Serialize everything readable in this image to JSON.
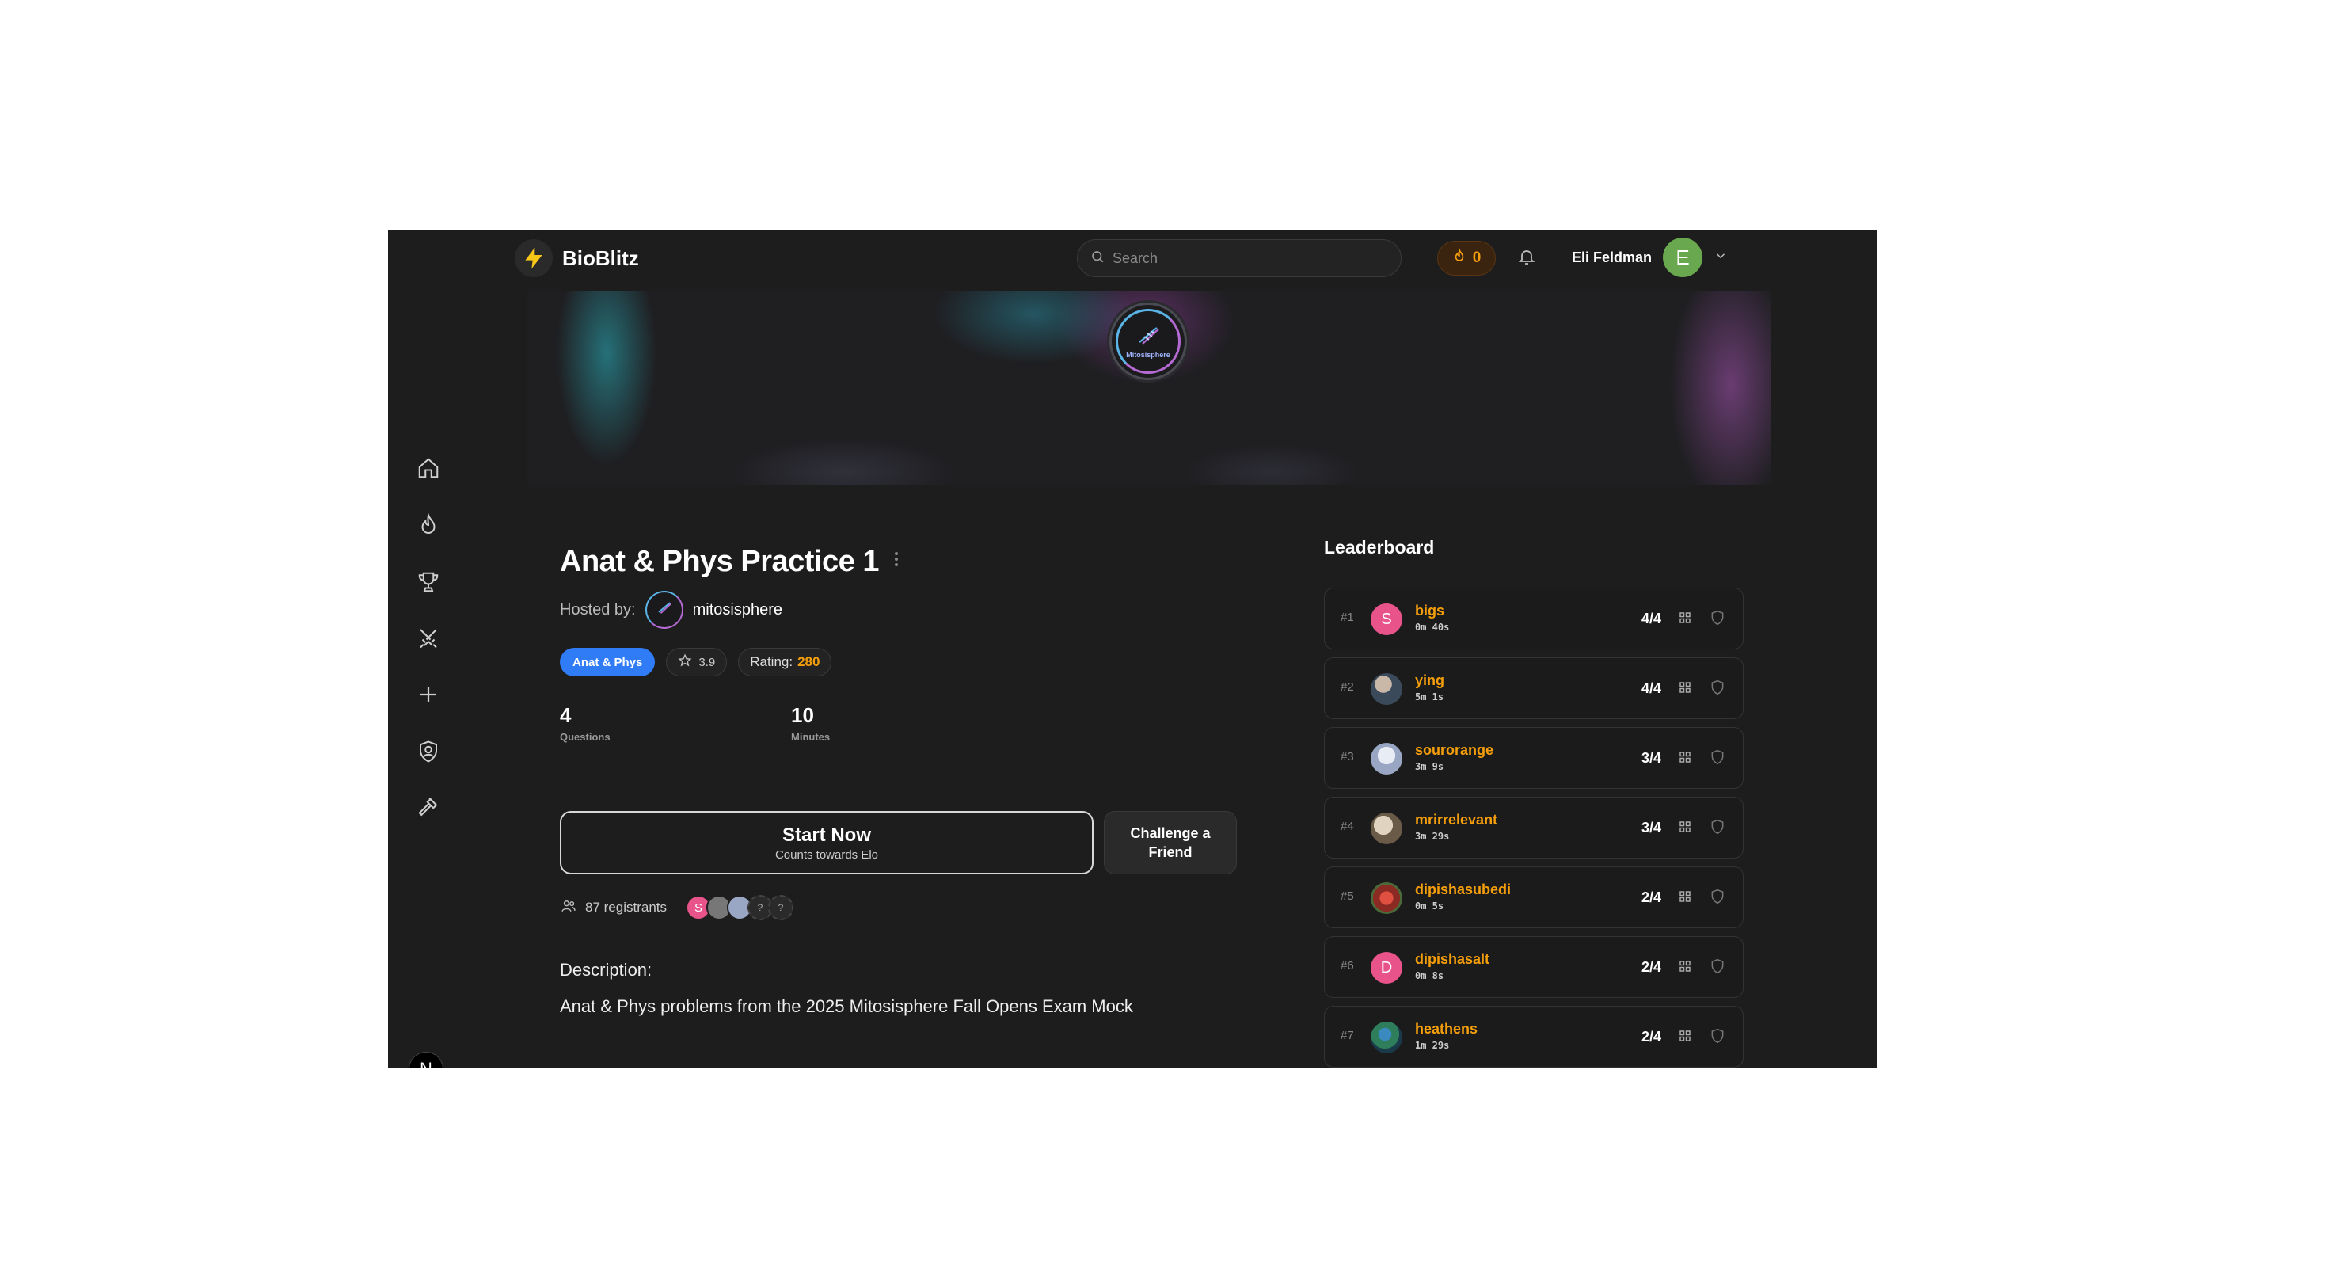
{
  "app": {
    "name": "BioBlitz",
    "brand_color": "#f5c518"
  },
  "header": {
    "search_placeholder": "Search",
    "streak_count": "0",
    "user_name": "Eli Feldman",
    "user_initial": "E",
    "user_avatar_color": "#6aa84f"
  },
  "sidebar": {
    "items": [
      {
        "icon": "home-icon"
      },
      {
        "icon": "flame-icon"
      },
      {
        "icon": "trophy-icon"
      },
      {
        "icon": "swords-icon"
      },
      {
        "icon": "plus-icon"
      },
      {
        "icon": "shield-user-icon"
      },
      {
        "icon": "hammer-icon"
      }
    ],
    "footer_badge": "N"
  },
  "banner": {
    "logo_text": "Mitosisphere"
  },
  "quiz": {
    "title": "Anat & Phys Practice 1",
    "hosted_by_label": "Hosted by:",
    "host_name": "mitosisphere",
    "subject_tag": "Anat & Phys",
    "star_rating": "3.9",
    "rating_label": "Rating:",
    "rating_value": "280",
    "questions_count": "4",
    "questions_label": "Questions",
    "minutes_count": "10",
    "minutes_label": "Minutes",
    "start_label": "Start Now",
    "start_sublabel": "Counts towards Elo",
    "challenge_label": "Challenge a Friend",
    "registrants_text": "87 registrants",
    "registrant_avatars": [
      {
        "label": "S",
        "color": "#e8548a"
      },
      {
        "label": "",
        "color": "#777777"
      },
      {
        "label": "",
        "color": "#9aa7c4"
      },
      {
        "label": "?",
        "color": "#2a2a2a"
      },
      {
        "label": "?",
        "color": "#2a2a2a"
      }
    ],
    "description_label": "Description:",
    "description": "Anat & Phys problems from the 2025 Mitosisphere Fall Opens Exam Mock"
  },
  "leaderboard": {
    "title": "Leaderboard",
    "rows": [
      {
        "rank": "#1",
        "name": "bigs",
        "time": "0m 40s",
        "score": "4/4",
        "initial": "S",
        "color": "#e8548a"
      },
      {
        "rank": "#2",
        "name": "ying",
        "time": "5m 1s",
        "score": "4/4",
        "initial": "",
        "color": "#5a6a7a"
      },
      {
        "rank": "#3",
        "name": "sourorange",
        "time": "3m 9s",
        "score": "3/4",
        "initial": "",
        "color": "#9aa7c4"
      },
      {
        "rank": "#4",
        "name": "mrirrelevant",
        "time": "3m 29s",
        "score": "3/4",
        "initial": "",
        "color": "#b8a890"
      },
      {
        "rank": "#5",
        "name": "dipishasubedi",
        "time": "0m 5s",
        "score": "2/4",
        "initial": "",
        "color": "#c0392b"
      },
      {
        "rank": "#6",
        "name": "dipishasalt",
        "time": "0m 8s",
        "score": "2/4",
        "initial": "D",
        "color": "#e8548a"
      },
      {
        "rank": "#7",
        "name": "heathens",
        "time": "1m 29s",
        "score": "2/4",
        "initial": "",
        "color": "#2e7d5b"
      }
    ]
  }
}
